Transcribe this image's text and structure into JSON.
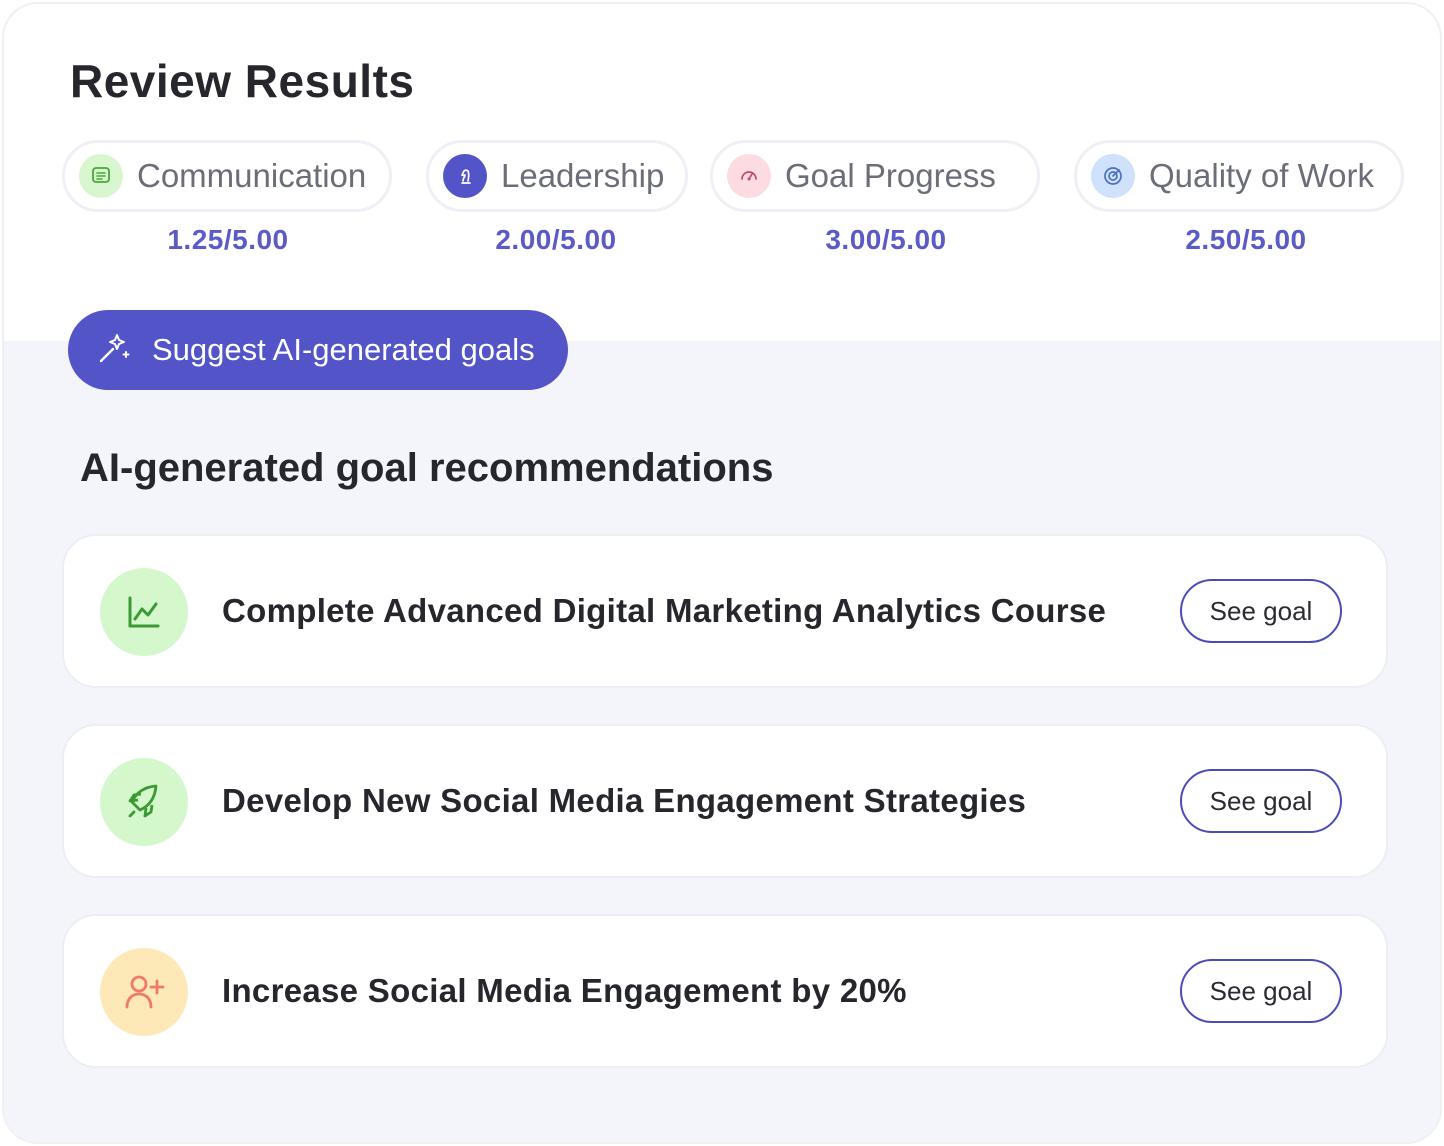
{
  "header": {
    "title": "Review Results"
  },
  "metrics": [
    {
      "label": "Communication",
      "score": "1.25/5.00",
      "icon": "chat-icon",
      "icon_bg": "#d9f7cf",
      "icon_color": "#47a83a"
    },
    {
      "label": "Leadership",
      "score": "2.00/5.00",
      "icon": "chess-knight-icon",
      "icon_bg": "#5254c8",
      "icon_color": "#ffffff"
    },
    {
      "label": "Goal Progress",
      "score": "3.00/5.00",
      "icon": "gauge-icon",
      "icon_bg": "#fddbe3",
      "icon_color": "#c24a63"
    },
    {
      "label": "Quality of Work",
      "score": "2.50/5.00",
      "icon": "target-icon",
      "icon_bg": "#cfe1fb",
      "icon_color": "#4b6fc2"
    }
  ],
  "ai_button": {
    "label": "Suggest AI-generated goals",
    "icon": "magic-wand-icon"
  },
  "recommendations": {
    "title": "AI-generated goal recommendations",
    "items": [
      {
        "title": "Complete Advanced Digital Marketing Analytics Course",
        "action": "See goal",
        "icon": "line-chart-icon",
        "icon_bg": "#d4f7cc",
        "icon_color": "#3b9a34"
      },
      {
        "title": "Develop New Social Media Engagement Strategies",
        "action": "See goal",
        "icon": "rocket-icon",
        "icon_bg": "#d4f7cc",
        "icon_color": "#3b9a34"
      },
      {
        "title": "Increase Social Media Engagement by 20%",
        "action": "See goal",
        "icon": "add-user-icon",
        "icon_bg": "#fde8b8",
        "icon_color": "#f07a6a"
      }
    ]
  },
  "colors": {
    "accent": "#5254c8",
    "score_text": "#5a5bc7",
    "panel_bg": "#f4f5fb"
  }
}
